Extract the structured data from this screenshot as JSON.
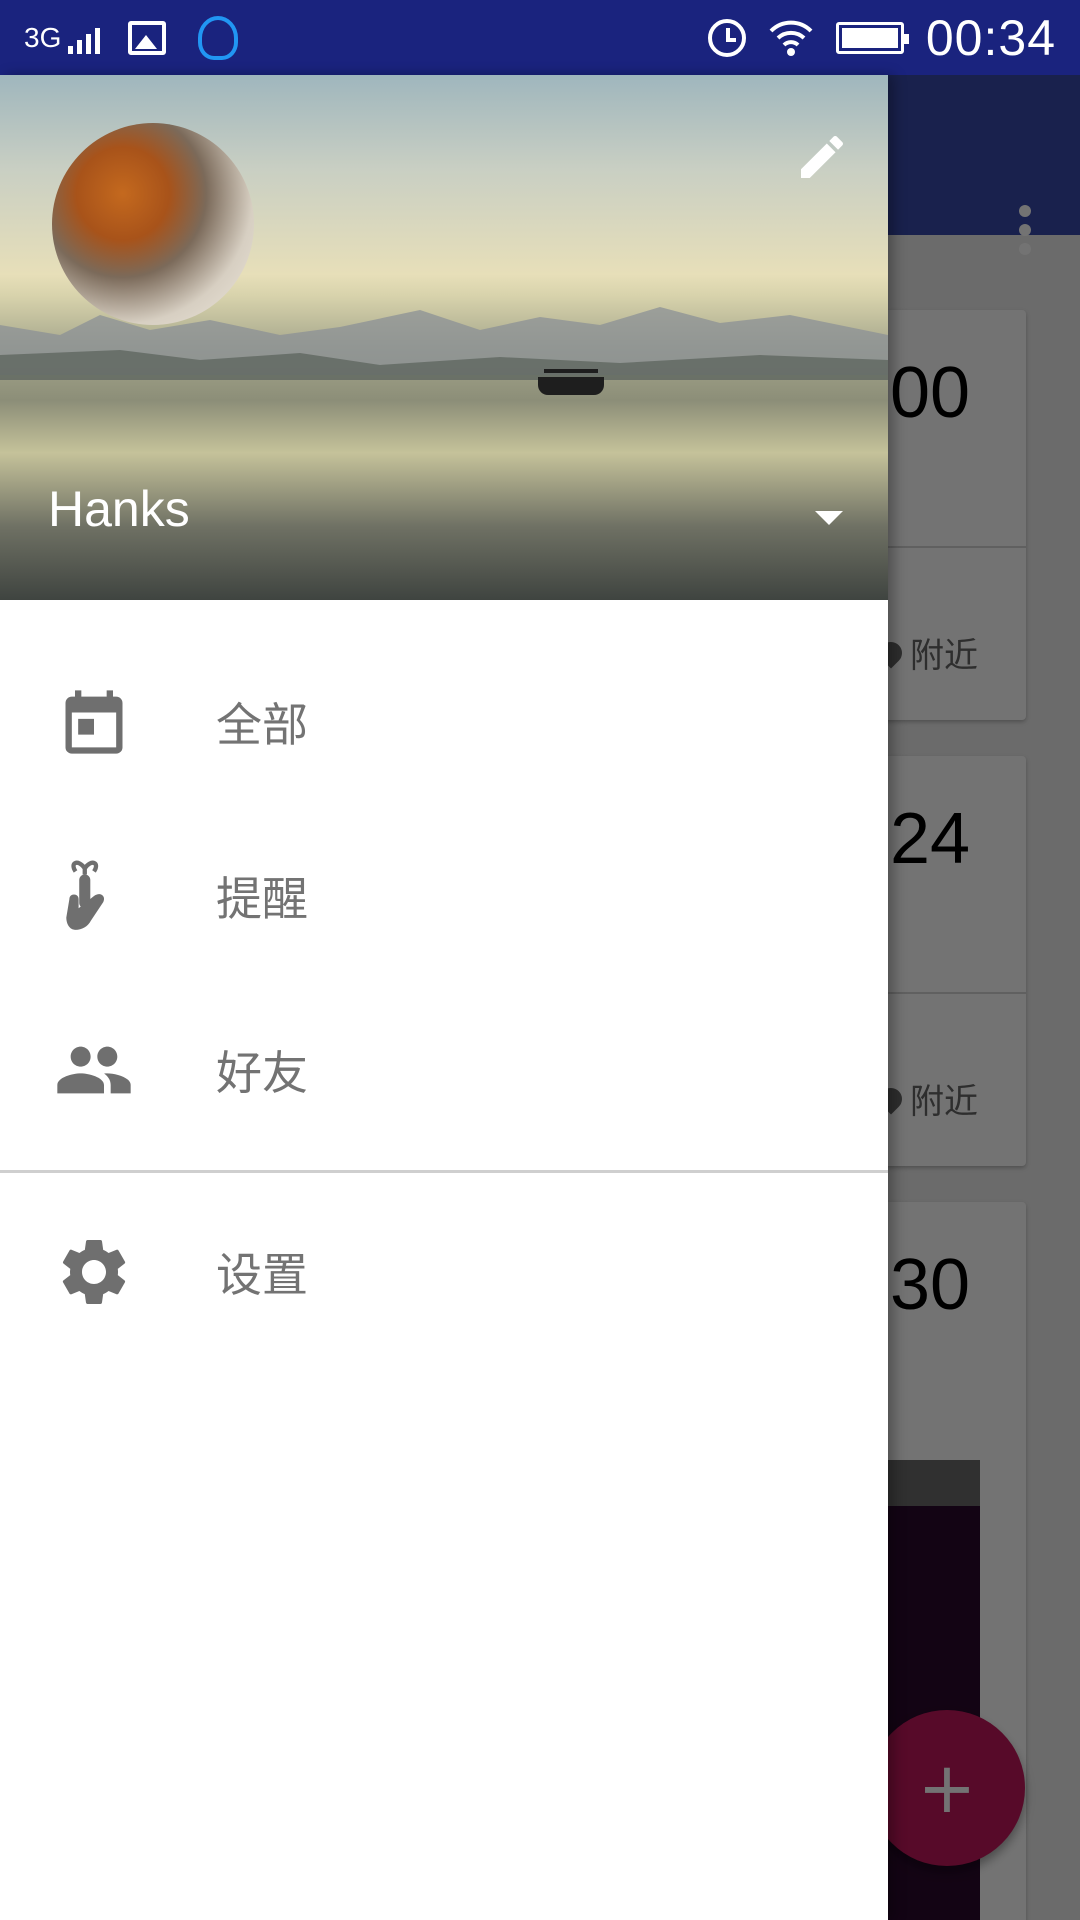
{
  "status_bar": {
    "network": "3G",
    "time": "00:34",
    "icons": [
      "signal-icon",
      "image-notification-icon",
      "qq-icon",
      "alarm-icon",
      "wifi-icon",
      "battery-icon"
    ]
  },
  "drawer": {
    "user_name": "Hanks",
    "icons": {
      "edit": "pencil-icon",
      "dropdown": "arrow-drop-down-icon"
    },
    "nav_items": [
      {
        "label": "全部",
        "icon": "calendar-icon"
      },
      {
        "label": "提醒",
        "icon": "reminder-finger-icon"
      },
      {
        "label": "好友",
        "icon": "people-icon"
      }
    ],
    "settings": {
      "label": "设置",
      "icon": "gear-icon"
    }
  },
  "background": {
    "cards": [
      {
        "time": "00",
        "location": "附近"
      },
      {
        "time": "24",
        "location": "附近"
      },
      {
        "time": "30"
      }
    ],
    "fab_label": "+"
  },
  "colors": {
    "status_bar": "#1a237e",
    "toolbar": "#3949ab",
    "fab": "#c2185b",
    "nav_icon": "#6f6f6f",
    "nav_text": "#737373"
  }
}
